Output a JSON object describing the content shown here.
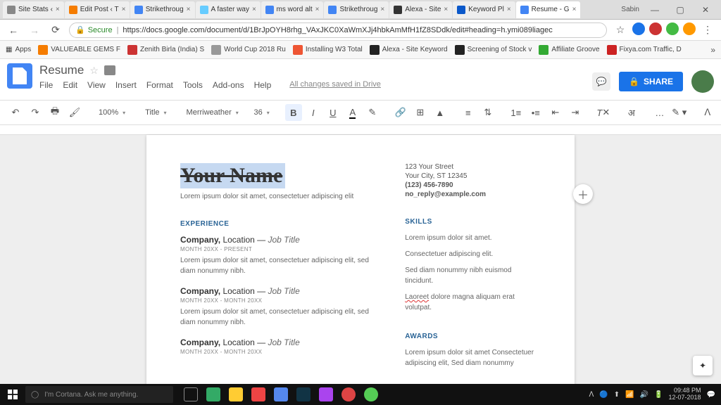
{
  "browser": {
    "tabs": [
      {
        "label": "Site Stats ‹"
      },
      {
        "label": "Edit Post ‹ T"
      },
      {
        "label": "Strikethroug"
      },
      {
        "label": "A faster way"
      },
      {
        "label": "ms word alt"
      },
      {
        "label": "Strikethroug"
      },
      {
        "label": "Alexa - Site"
      },
      {
        "label": "Keyword Pl"
      },
      {
        "label": "Resume - G",
        "active": true
      }
    ],
    "user_label": "Sabin",
    "nav": {
      "back": "←",
      "fwd": "→",
      "reload": "⟳"
    },
    "secure": "Secure",
    "lock": "🔒",
    "url": "https://docs.google.com/document/d/1BrJpOYH8rhg_VAxJKC0XaWmXJj4hbkAmMfH1fZ8SDdk/edit#heading=h.ymi089liagec",
    "bookmarks": [
      {
        "label": "Apps"
      },
      {
        "label": "VALUEABLE GEMS F"
      },
      {
        "label": "Zenith Birla (India) S"
      },
      {
        "label": "World Cup 2018 Ru"
      },
      {
        "label": "Installing W3 Total"
      },
      {
        "label": "Alexa - Site Keyword"
      },
      {
        "label": "Screening of Stock v"
      },
      {
        "label": "Affiliate Groove"
      },
      {
        "label": "Fixya.com Traffic, D"
      }
    ]
  },
  "docs": {
    "title": "Resume",
    "menus": [
      "File",
      "Edit",
      "View",
      "Insert",
      "Format",
      "Tools",
      "Add-ons",
      "Help"
    ],
    "changes": "All changes saved in Drive",
    "share": "SHARE",
    "toolbar": {
      "zoom": "100%",
      "style": "Title",
      "font": "Merriweather",
      "size": "36"
    }
  },
  "resume": {
    "name": "Your Name",
    "sub": "Lorem ipsum dolor sit amet, consectetuer adipiscing elit",
    "contact": {
      "street": "123 Your Street",
      "city": "Your City, ST 12345",
      "phone": "(123) 456-7890",
      "email": "no_reply@example.com"
    },
    "sec_exp": "EXPERIENCE",
    "jobs": [
      {
        "title": "Company, Location — Job Title",
        "dates": "MONTH 20XX - PRESENT",
        "body": "Lorem ipsum dolor sit amet, consectetuer adipiscing elit, sed diam nonummy nibh."
      },
      {
        "title": "Company, Location — Job Title",
        "dates": "MONTH 20XX - MONTH 20XX",
        "body": "Lorem ipsum dolor sit amet, consectetuer adipiscing elit, sed diam nonummy nibh."
      },
      {
        "title": "Company, Location — Job Title",
        "dates": "MONTH 20XX - MONTH 20XX",
        "body": ""
      }
    ],
    "sec_skills": "SKILLS",
    "skills": [
      "Lorem ipsum dolor sit amet.",
      "Consectetuer adipiscing elit.",
      "Sed diam nonummy nibh euismod tincidunt."
    ],
    "skill_red_pre": "Laoreet",
    "skill_red_post": " dolore magna aliquam erat volutpat.",
    "sec_awards": "AWARDS",
    "awards_body": "Lorem ipsum dolor sit amet Consectetuer adipiscing elit, Sed diam nonummy"
  },
  "taskbar": {
    "cortana": "I'm Cortana. Ask me anything.",
    "time": "09:48 PM",
    "date": "12-07-2018"
  }
}
